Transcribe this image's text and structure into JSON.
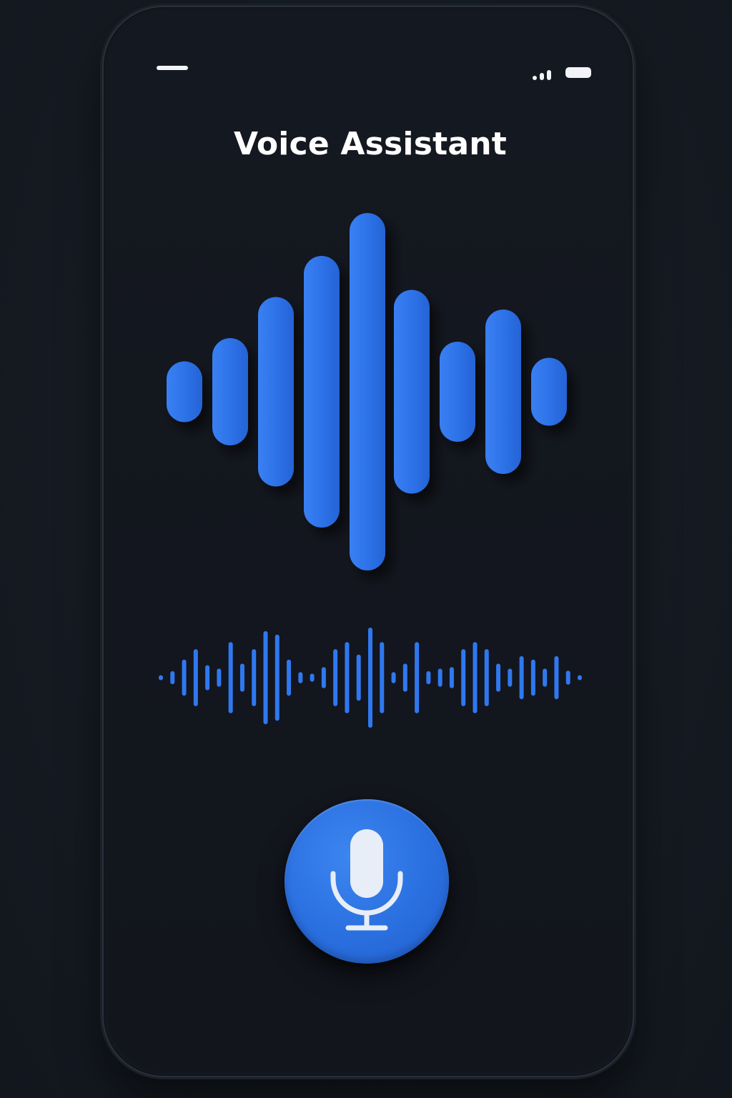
{
  "app": {
    "title": "Voice Assistant"
  },
  "status_bar": {
    "signal_icon": "signal-bars-icon",
    "battery_icon": "battery-icon"
  },
  "waveform_large": {
    "bar_levels": [
      0.17,
      0.3,
      0.53,
      0.76,
      1.0,
      0.57,
      0.28,
      0.46,
      0.19
    ],
    "color": "#2f6fe6"
  },
  "waveform_small": {
    "bar_levels": [
      0.05,
      0.13,
      0.36,
      0.57,
      0.25,
      0.18,
      0.71,
      0.28,
      0.57,
      0.93,
      0.86,
      0.36,
      0.11,
      0.08,
      0.21,
      0.57,
      0.71,
      0.46,
      1.0,
      0.71,
      0.11,
      0.28,
      0.71,
      0.13,
      0.18,
      0.21,
      0.57,
      0.71,
      0.57,
      0.28,
      0.18,
      0.43,
      0.36,
      0.18,
      0.43,
      0.14,
      0.05
    ],
    "color": "#2f78f0"
  },
  "mic_button": {
    "icon": "microphone-icon",
    "color": "#2a6fe0"
  },
  "colors": {
    "background": "#161b24",
    "phone": "#14171e",
    "accent": "#2f6fe6",
    "text": "#ffffff"
  }
}
